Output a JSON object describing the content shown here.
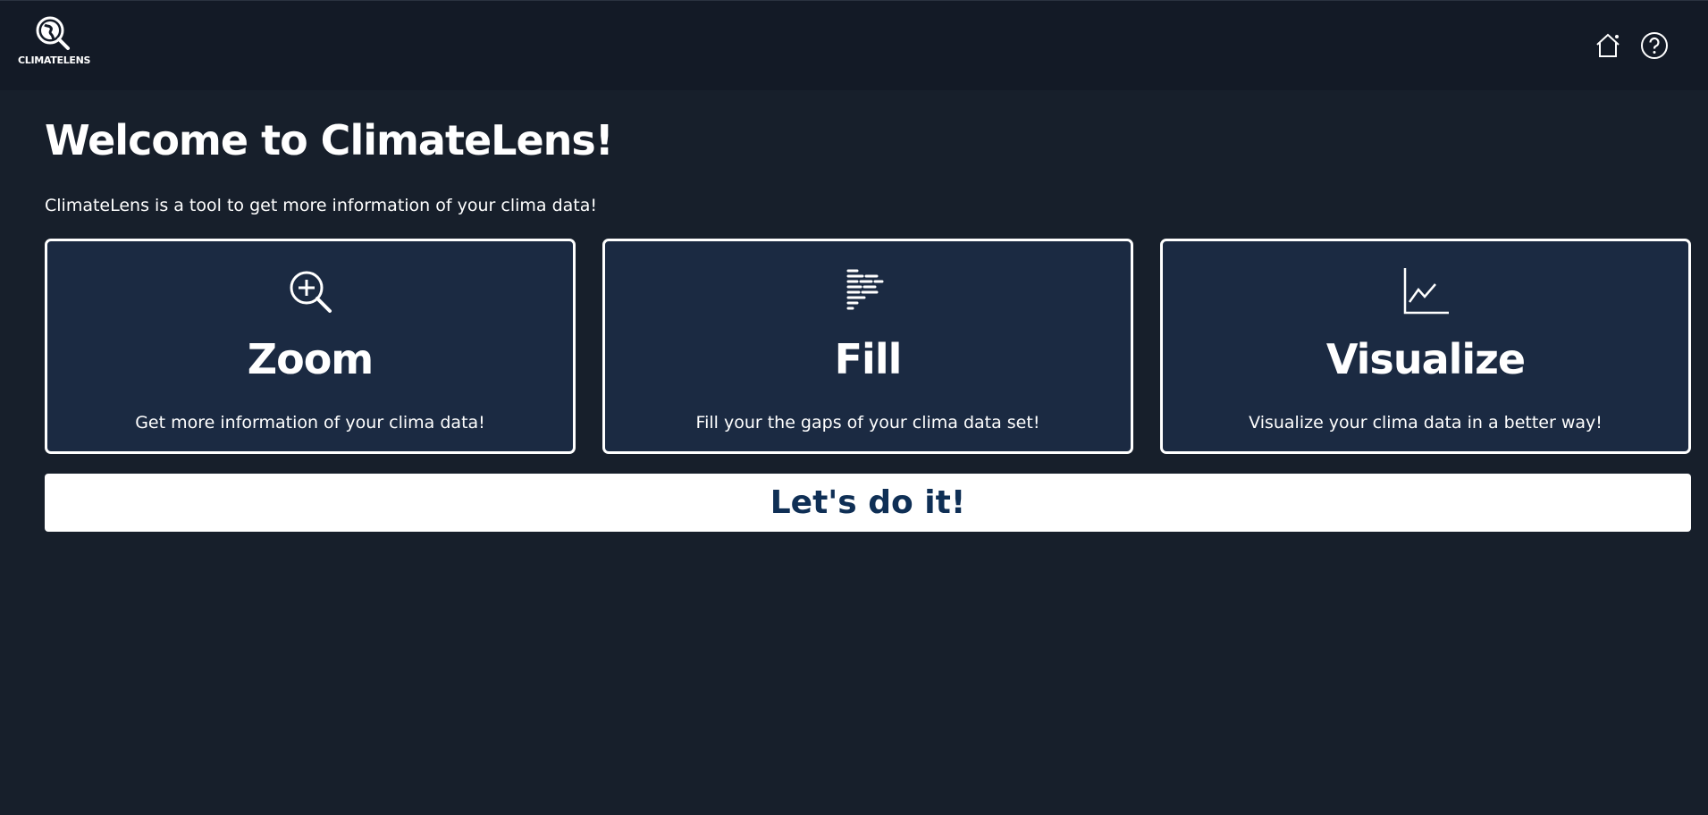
{
  "header": {
    "logo_text": "CLIMATELENS"
  },
  "main": {
    "title": "Welcome to ClimateLens!",
    "subtitle": "ClimateLens is a tool to get more information of your clima data!",
    "cards": [
      {
        "title": "Zoom",
        "description": "Get more information of your clima data!",
        "icon": "zoom-in-icon"
      },
      {
        "title": "Fill",
        "description": "Fill your the gaps of your clima data set!",
        "icon": "fill-lines-icon"
      },
      {
        "title": "Visualize",
        "description": "Visualize your clima data in a better way!",
        "icon": "line-chart-icon"
      }
    ],
    "cta_label": "Let's do it!"
  }
}
